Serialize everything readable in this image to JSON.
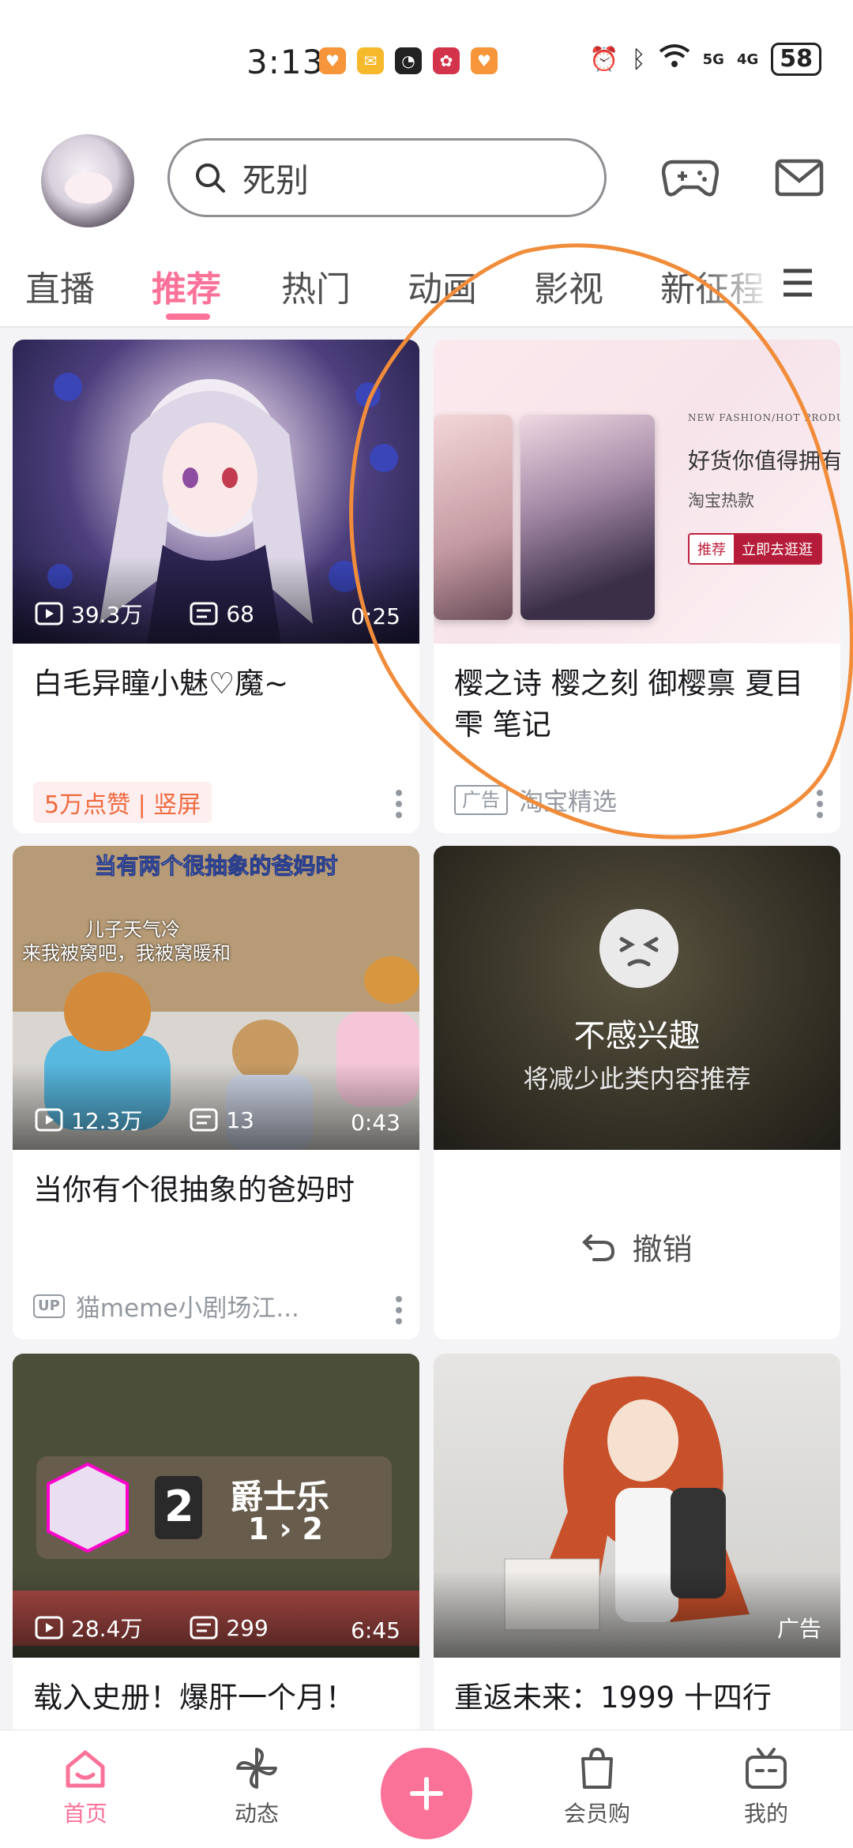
{
  "status_bar": {
    "time": "3:13",
    "battery": "58",
    "signal_labels": [
      "5G",
      "4G"
    ]
  },
  "header": {
    "search_text": "死别"
  },
  "tabs": [
    {
      "label": "直播"
    },
    {
      "label": "推荐",
      "active": true
    },
    {
      "label": "热门"
    },
    {
      "label": "动画"
    },
    {
      "label": "影视"
    },
    {
      "label": "新征程"
    }
  ],
  "feed": [
    {
      "views": "39.3万",
      "comments": "68",
      "duration": "0:25",
      "title": "白毛异瞳小魅♡魔~",
      "badge": "5万点赞 | 竖屏"
    },
    {
      "ad_image": {
        "kicker": "NEW FASHION/HOT PRODUCT",
        "headline": "好货你值得拥有",
        "sub": "淘宝热款",
        "cta_left": "推荐",
        "cta_right": "立即去逛逛"
      },
      "title": "樱之诗 樱之刻 御樱禀 夏目雫 笔记",
      "ad_label": "广告",
      "source": "淘宝精选"
    },
    {
      "views": "12.3万",
      "comments": "13",
      "duration": "0:43",
      "overlay_top": "当有两个很抽象的爸妈时",
      "overlay_caption_1": "儿子天气冷",
      "overlay_caption_2": "来我被窝吧，我被窝暖和",
      "title": "当你有个很抽象的爸妈时",
      "up_label": "UP",
      "author": "猫meme小剧场江..."
    },
    {
      "not_interested_title": "不感兴趣",
      "not_interested_sub": "将减少此类内容推荐",
      "undo_label": "撤销"
    },
    {
      "views": "28.4万",
      "comments": "299",
      "duration": "6:45",
      "overlay_big": "爵士乐",
      "overlay_rank": "2",
      "overlay_score": "1 › 2",
      "title": "载入史册！爆肝一个月！"
    },
    {
      "ad_tag": "广告",
      "title": "重返未来：1999 十四行"
    }
  ],
  "bottom_nav": [
    {
      "label": "首页",
      "active": true
    },
    {
      "label": "动态"
    },
    {
      "label": "会员购"
    },
    {
      "label": "我的"
    }
  ],
  "colors": {
    "accent": "#fb7299",
    "annotation": "#f08c3a"
  }
}
